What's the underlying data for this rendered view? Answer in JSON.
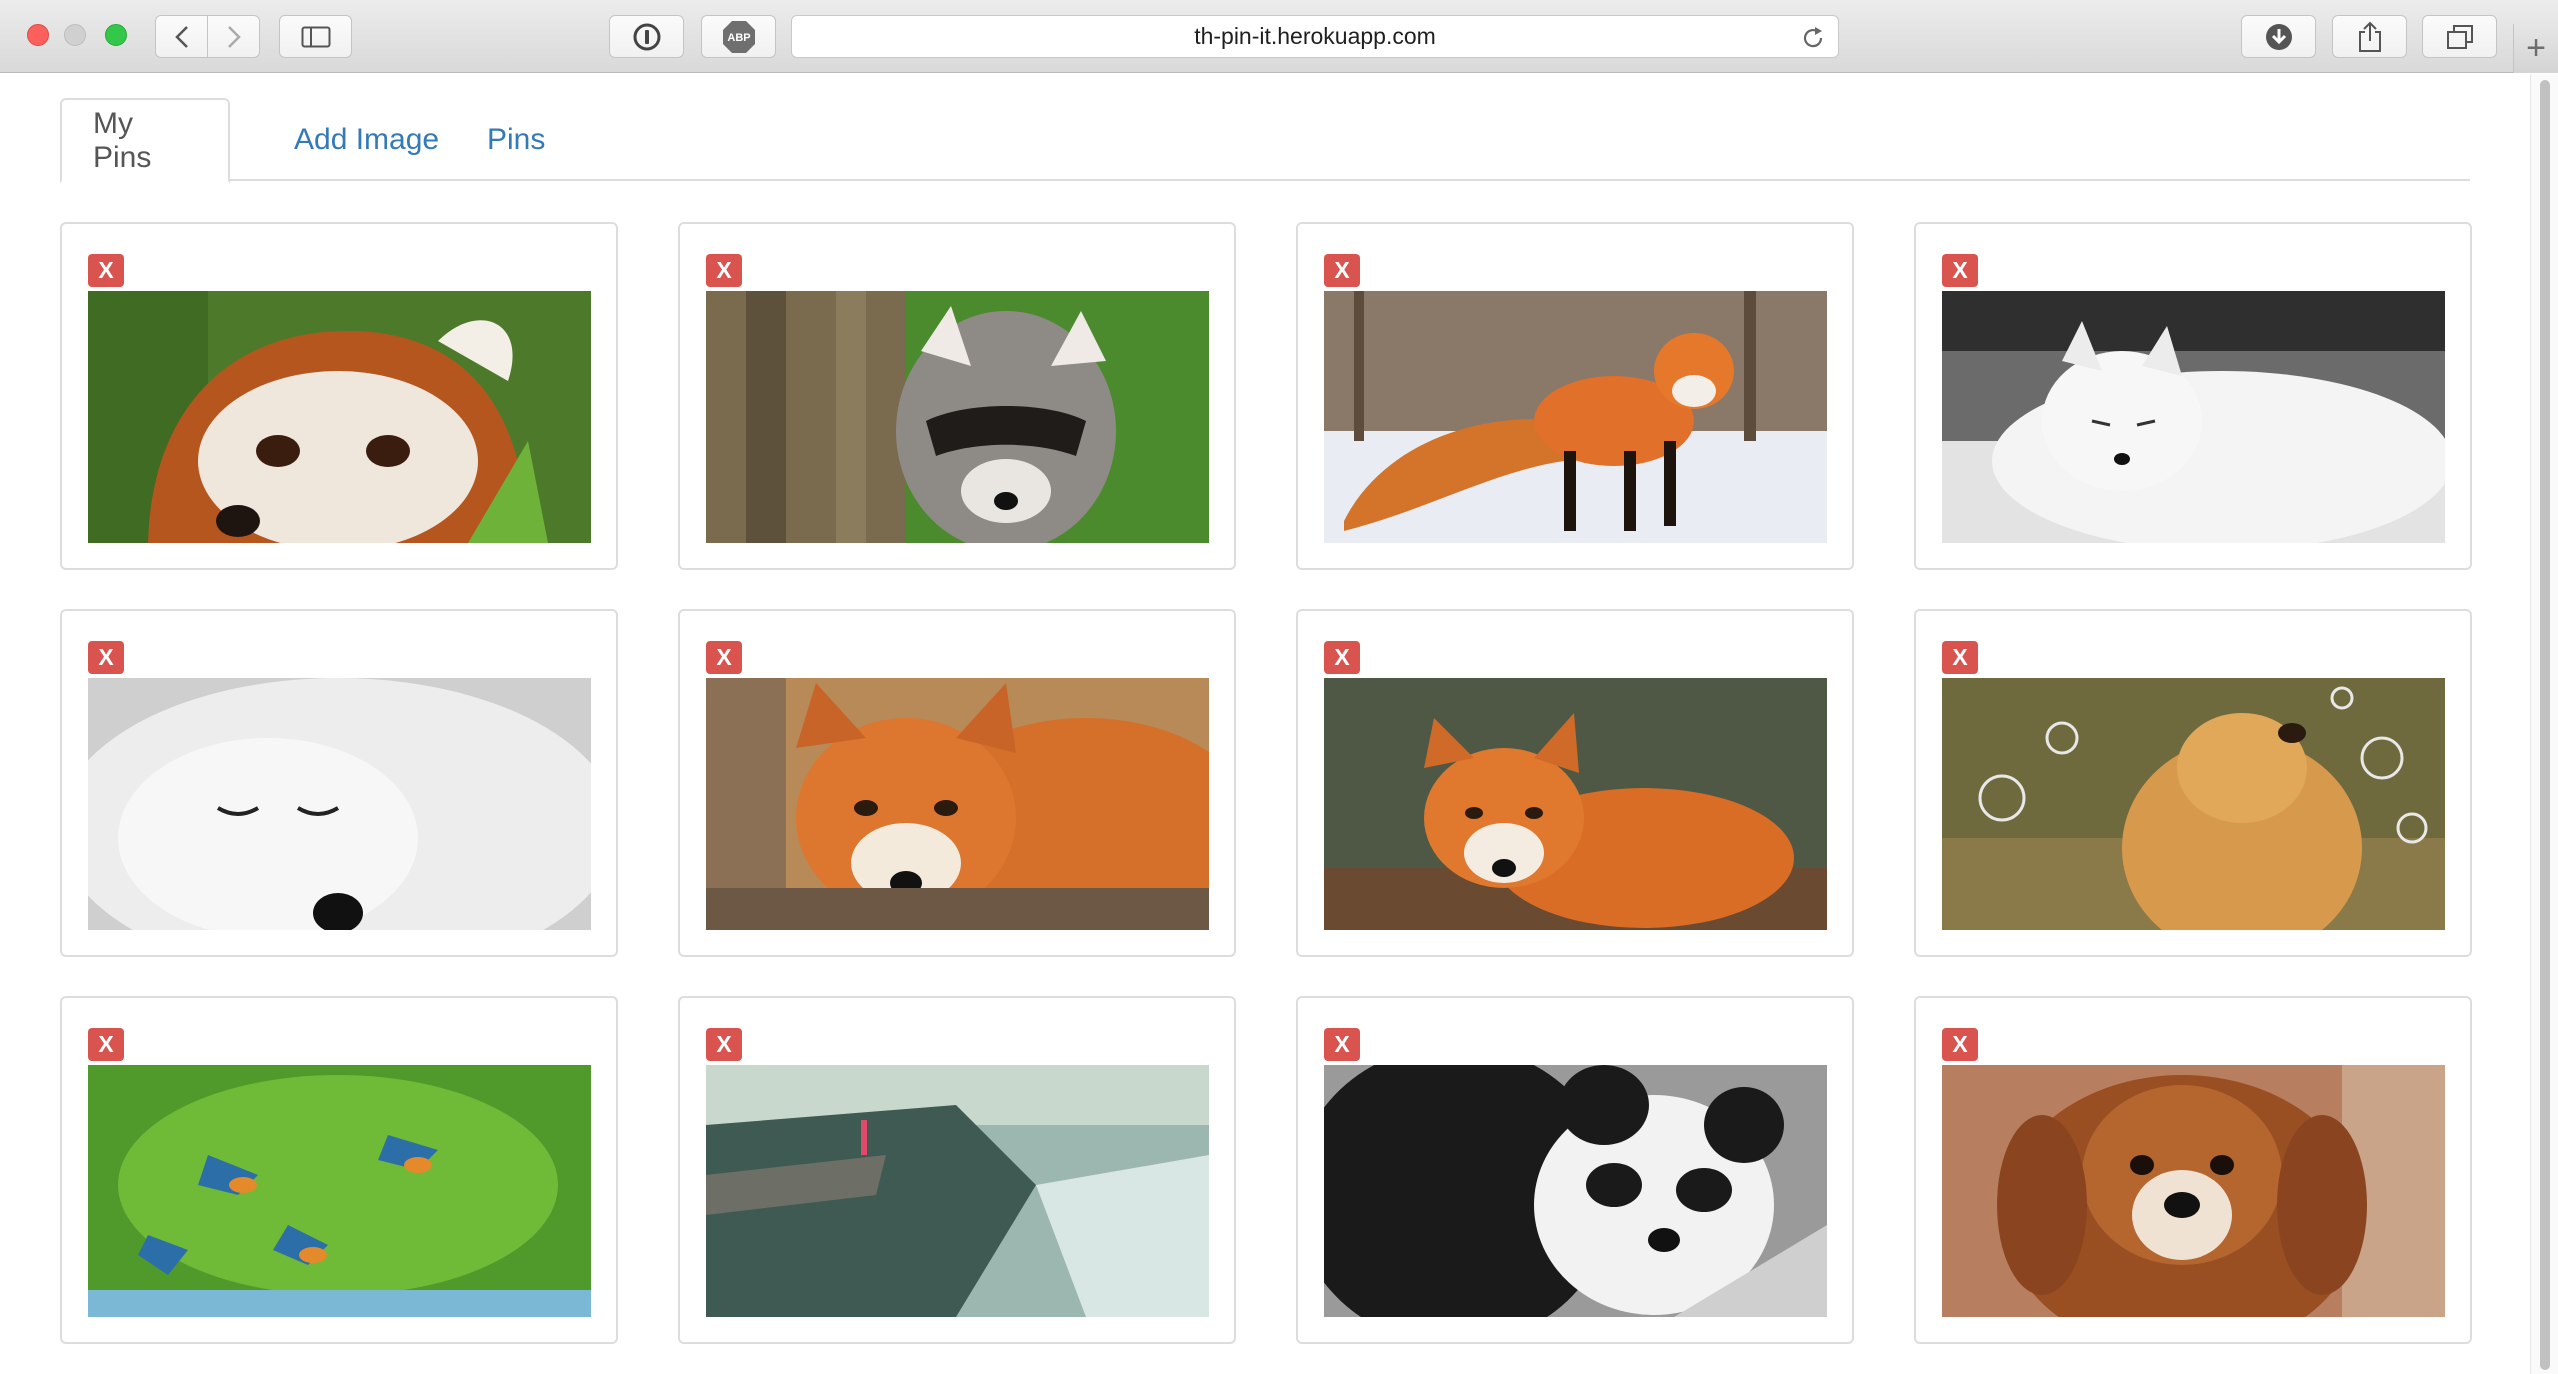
{
  "browser": {
    "url": "th-pin-it.herokuapp.com",
    "adblock_label": "ABP"
  },
  "tabs": [
    {
      "label": "My Pins"
    },
    {
      "label": "Add Image"
    },
    {
      "label": "Pins"
    }
  ],
  "pins": [
    {
      "delete_label": "X",
      "subject": "red panda"
    },
    {
      "delete_label": "X",
      "subject": "raccoon"
    },
    {
      "delete_label": "X",
      "subject": "red fox in snow"
    },
    {
      "delete_label": "X",
      "subject": "arctic fox"
    },
    {
      "delete_label": "X",
      "subject": "sleeping white fox"
    },
    {
      "delete_label": "X",
      "subject": "resting red fox"
    },
    {
      "delete_label": "X",
      "subject": "fox in leaves"
    },
    {
      "delete_label": "X",
      "subject": "golden retriever with bubbles"
    },
    {
      "delete_label": "X",
      "subject": "kingfishers"
    },
    {
      "delete_label": "X",
      "subject": "cliff over fjord"
    },
    {
      "delete_label": "X",
      "subject": "panda"
    },
    {
      "delete_label": "X",
      "subject": "curly puppy"
    }
  ],
  "colors": {
    "link": "#337ab7",
    "delete": "#d9534f",
    "border": "#dddddd"
  }
}
